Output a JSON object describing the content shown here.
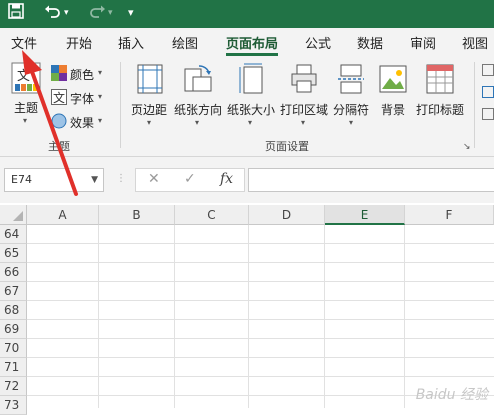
{
  "quick_access": {
    "save_icon": "save-icon",
    "undo_icon": "undo-icon",
    "redo_icon": "redo-icon",
    "customize_icon": "customize-qat-icon"
  },
  "tabs": [
    "文件",
    "开始",
    "插入",
    "绘图",
    "页面布局",
    "公式",
    "数据",
    "审阅",
    "视图"
  ],
  "active_tab": "页面布局",
  "ribbon": {
    "theme_group": {
      "themes": "主题",
      "colors": "颜色",
      "fonts": "字体",
      "effects": "效果",
      "label": "主题"
    },
    "page_setup_group": {
      "margins": "页边距",
      "orientation": "纸张方向",
      "size": "纸张大小",
      "print_area": "打印区域",
      "breaks": "分隔符",
      "background": "背景",
      "print_titles": "打印标题",
      "label": "页面设置"
    }
  },
  "formula_bar": {
    "name_box": "E74",
    "cancel": "✕",
    "enter": "✓",
    "fx": "fx",
    "formula": ""
  },
  "grid": {
    "columns": [
      "A",
      "B",
      "C",
      "D",
      "E",
      "F"
    ],
    "selected_column": "E",
    "rows": [
      "64",
      "65",
      "66",
      "67",
      "68",
      "69",
      "70",
      "71",
      "72",
      "73"
    ]
  },
  "watermark": "Baidu 经验",
  "colors": {
    "excel_green": "#217346",
    "arrow_red": "#e0302a"
  }
}
